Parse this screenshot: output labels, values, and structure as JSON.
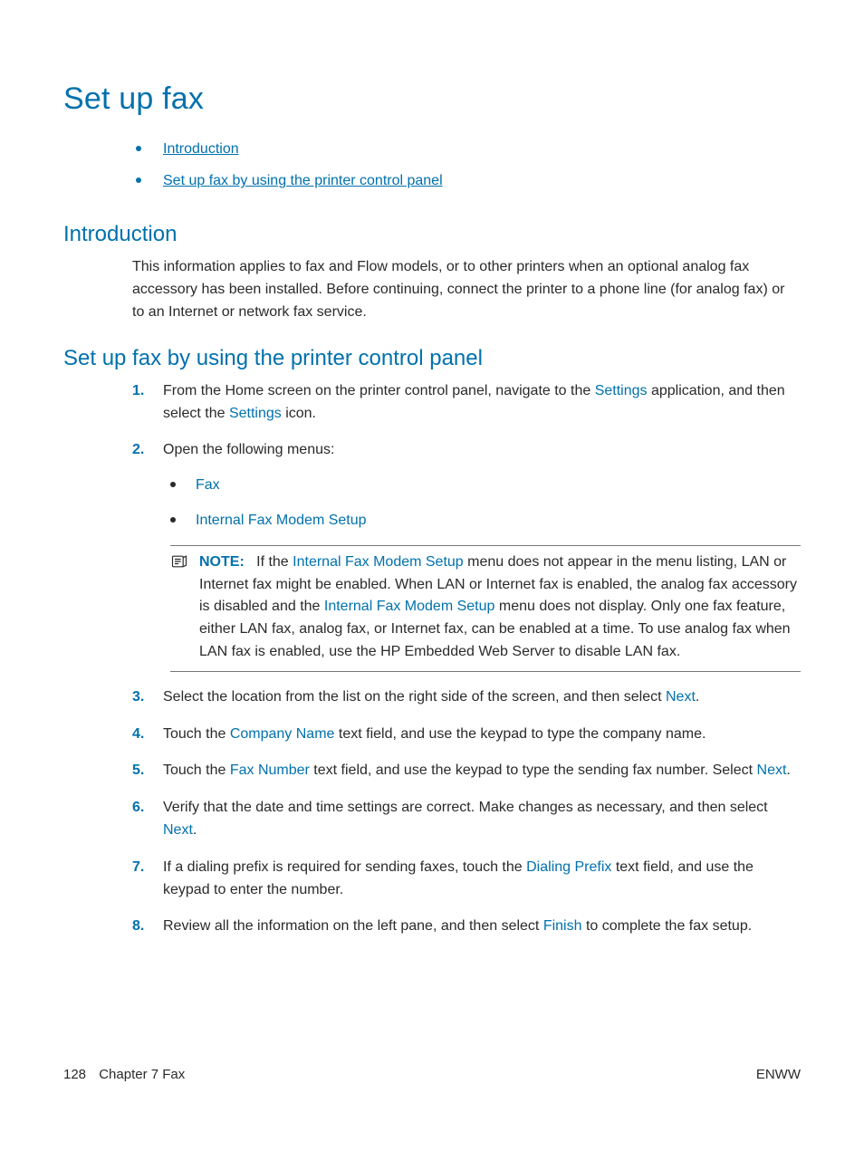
{
  "title": "Set up fax",
  "toc": {
    "items": [
      {
        "label": "Introduction"
      },
      {
        "label": "Set up fax by using the printer control panel"
      }
    ]
  },
  "sections": {
    "intro": {
      "heading": "Introduction",
      "para": "This information applies to fax and Flow models, or to other printers when an optional analog fax accessory has been installed. Before continuing, connect the printer to a phone line (for analog fax) or to an Internet or network fax service."
    },
    "setup": {
      "heading": "Set up fax by using the printer control panel",
      "steps": {
        "s1": {
          "pre": "From the Home screen on the printer control panel, navigate to the ",
          "ui1": "Settings",
          "mid": " application, and then select the ",
          "ui2": "Settings",
          "post": " icon."
        },
        "s2": {
          "text": "Open the following menus:",
          "bullets": [
            "Fax",
            "Internal Fax Modem Setup"
          ],
          "note": {
            "label": "NOTE:",
            "pre": "If the ",
            "ui1": "Internal Fax Modem Setup",
            "mid1": " menu does not appear in the menu listing, LAN or Internet fax might be enabled. When LAN or Internet fax is enabled, the analog fax accessory is disabled and the ",
            "ui2": "Internal Fax Modem Setup",
            "post": " menu does not display. Only one fax feature, either LAN fax, analog fax, or Internet fax, can be enabled at a time. To use analog fax when LAN fax is enabled, use the HP Embedded Web Server to disable LAN fax."
          }
        },
        "s3": {
          "pre": "Select the location from the list on the right side of the screen, and then select ",
          "ui1": "Next",
          "post": "."
        },
        "s4": {
          "pre": "Touch the ",
          "ui1": "Company Name",
          "post": " text field, and use the keypad to type the company name."
        },
        "s5": {
          "pre": "Touch the ",
          "ui1": "Fax Number",
          "mid": " text field, and use the keypad to type the sending fax number. Select ",
          "ui2": "Next",
          "post": "."
        },
        "s6": {
          "pre": "Verify that the date and time settings are correct. Make changes as necessary, and then select ",
          "ui1": "Next",
          "post": "."
        },
        "s7": {
          "pre": "If a dialing prefix is required for sending faxes, touch the ",
          "ui1": "Dialing Prefix",
          "post": " text field, and use the keypad to enter the number."
        },
        "s8": {
          "pre": "Review all the information on the left pane, and then select ",
          "ui1": "Finish",
          "post": " to complete the fax setup."
        }
      }
    }
  },
  "footer": {
    "page": "128",
    "chapter": "Chapter 7   Fax",
    "right": "ENWW"
  }
}
